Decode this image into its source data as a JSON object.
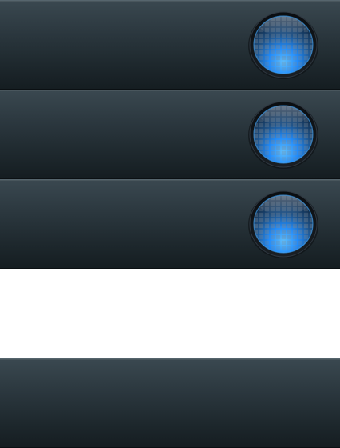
{
  "panels": [
    {
      "id": "panel-1",
      "has_orb_button": true,
      "orb_icon": "globe-grid-icon"
    },
    {
      "id": "panel-2",
      "has_orb_button": true,
      "orb_icon": "globe-grid-icon"
    },
    {
      "id": "panel-3",
      "has_orb_button": true,
      "orb_icon": "globe-grid-icon"
    },
    {
      "id": "panel-4",
      "has_orb_button": false
    }
  ],
  "colors": {
    "panel_top": "#3a4850",
    "panel_bottom": "#151d21",
    "orb_glow": "#1e8cff",
    "orb_dark": "#4a5560",
    "background": "#ffffff"
  }
}
